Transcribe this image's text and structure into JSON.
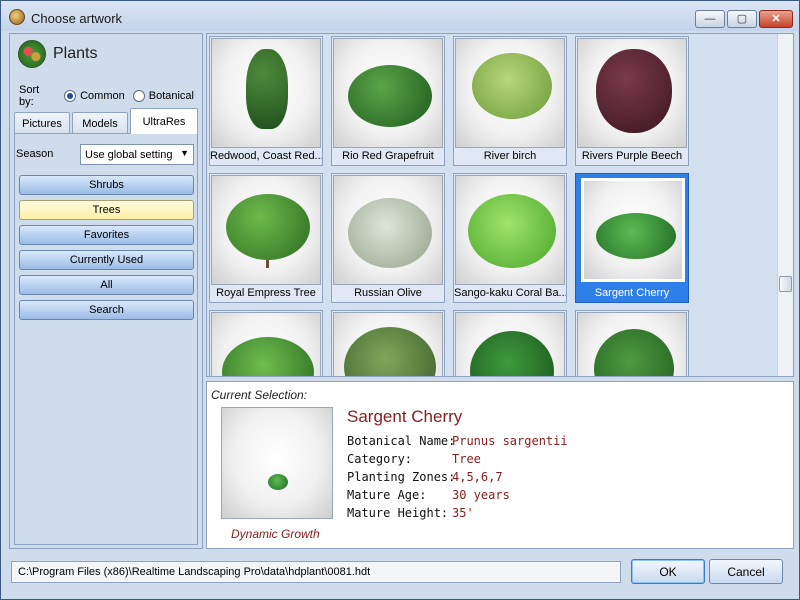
{
  "window": {
    "title": "Choose artwork",
    "controls": {
      "minimize": "—",
      "maximize": "▢",
      "close": "✕"
    }
  },
  "left_panel": {
    "title": "Plants",
    "sort_by": {
      "label": "Sort by:",
      "options": [
        {
          "label": "Common",
          "selected": true
        },
        {
          "label": "Botanical",
          "selected": false
        }
      ]
    },
    "tabs": [
      "Pictures",
      "Models",
      "UltraRes"
    ],
    "active_tab": "UltraRes",
    "season": {
      "label": "Season",
      "value": "Use global setting"
    },
    "categories": [
      "Shrubs",
      "Trees",
      "Favorites",
      "Currently Used",
      "All",
      "Search"
    ],
    "selected_category": "Trees"
  },
  "grid": {
    "items": [
      {
        "name": "Redwood, Coast Red...",
        "selected": false
      },
      {
        "name": "Rio Red Grapefruit",
        "selected": false
      },
      {
        "name": "River birch",
        "selected": false
      },
      {
        "name": "Rivers Purple Beech",
        "selected": false
      },
      {
        "name": "Royal Empress Tree",
        "selected": false
      },
      {
        "name": "Russian Olive",
        "selected": false
      },
      {
        "name": "Sango-kaku Coral Ba...",
        "selected": false
      },
      {
        "name": "Sargent Cherry",
        "selected": true
      },
      {
        "name": "",
        "selected": false
      },
      {
        "name": "",
        "selected": false
      },
      {
        "name": "",
        "selected": false
      },
      {
        "name": "",
        "selected": false
      }
    ]
  },
  "details": {
    "label": "Current Selection:",
    "name": "Sargent Cherry",
    "growth_link": "Dynamic Growth",
    "attributes": [
      {
        "label": "Botanical Name:",
        "value": "Prunus sargentii"
      },
      {
        "label": "Category:",
        "value": "Tree"
      },
      {
        "label": "Planting Zones:",
        "value": "4,5,6,7"
      },
      {
        "label": "Mature Age:",
        "value": "30 years"
      },
      {
        "label": "Mature Height:",
        "value": "35'"
      }
    ]
  },
  "footer": {
    "path": "C:\\Program Files (x86)\\Realtime Landscaping Pro\\data\\hdplant\\0081.hdt",
    "ok_label": "OK",
    "cancel_label": "Cancel"
  },
  "colors": {
    "accent": "#2f7fe8",
    "detail_text": "#8a1c1c",
    "selected_category": "#fff0a6"
  }
}
